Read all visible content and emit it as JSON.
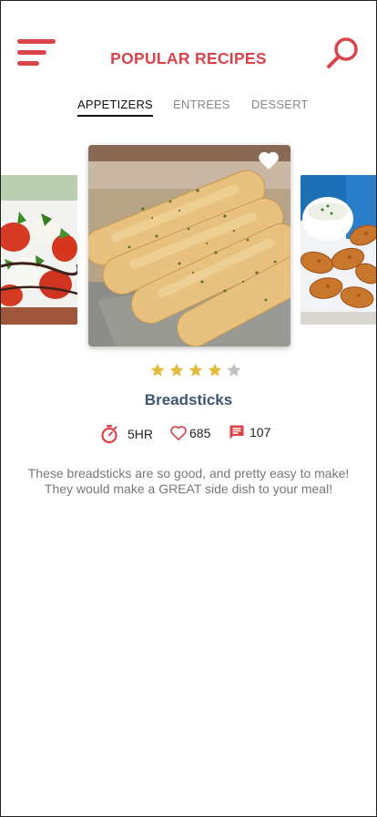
{
  "header": {
    "title": "POPULAR RECIPES",
    "menu_icon": "menu-icon",
    "search_icon": "search-icon"
  },
  "tabs": [
    {
      "label": "APPETIZERS",
      "active": true
    },
    {
      "label": "ENTREES",
      "active": false
    },
    {
      "label": "DESSERT",
      "active": false
    }
  ],
  "carousel": {
    "items": [
      {
        "name": "caprese-salad-image"
      },
      {
        "name": "breadsticks-image",
        "favorite_icon": "heart-icon"
      },
      {
        "name": "chicken-wings-image"
      }
    ]
  },
  "recipe": {
    "title": "Breadsticks",
    "rating": 4,
    "rating_max": 5,
    "time": "5HR",
    "likes": "685",
    "comments": "107",
    "description": "These breadsticks are so good, and pretty easy to make! They would make a GREAT side dish to your meal!"
  },
  "colors": {
    "accent": "#d9434a",
    "title_text": "#3d5673",
    "star_filled": "#e2bb3d",
    "star_empty": "#bfbfbf"
  }
}
